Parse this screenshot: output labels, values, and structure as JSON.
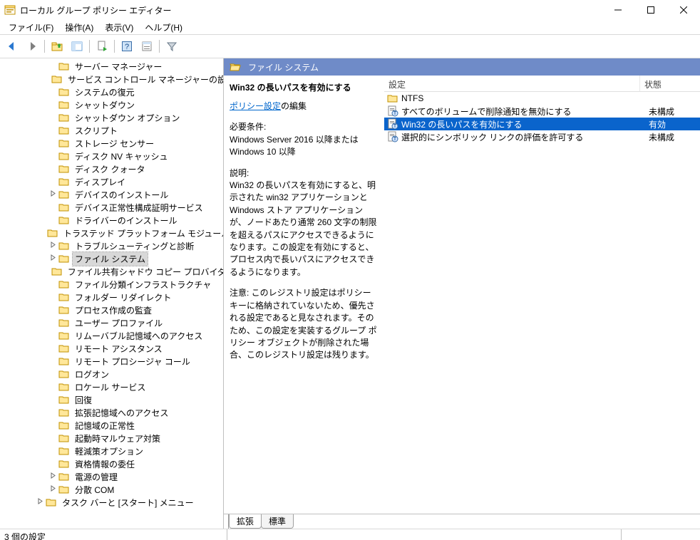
{
  "window": {
    "title": "ローカル グループ ポリシー エディター"
  },
  "menus": [
    "ファイル(F)",
    "操作(A)",
    "表示(V)",
    "ヘルプ(H)"
  ],
  "tree": {
    "indent_base": 66,
    "nodes": [
      {
        "label": "サーバー マネージャー",
        "children": false
      },
      {
        "label": "サービス コントロール マネージャーの設定",
        "children": false
      },
      {
        "label": "システムの復元",
        "children": false
      },
      {
        "label": "シャットダウン",
        "children": false
      },
      {
        "label": "シャットダウン オプション",
        "children": false
      },
      {
        "label": "スクリプト",
        "children": false
      },
      {
        "label": "ストレージ センサー",
        "children": false
      },
      {
        "label": "ディスク NV キャッシュ",
        "children": false
      },
      {
        "label": "ディスク クォータ",
        "children": false
      },
      {
        "label": "ディスプレイ",
        "children": false
      },
      {
        "label": "デバイスのインストール",
        "children": true
      },
      {
        "label": "デバイス正常性構成証明サービス",
        "children": false
      },
      {
        "label": "ドライバーのインストール",
        "children": false
      },
      {
        "label": "トラステッド プラットフォーム モジュール サー",
        "children": false
      },
      {
        "label": "トラブルシューティングと診断",
        "children": true
      },
      {
        "label": "ファイル システム",
        "children": true,
        "active": true
      },
      {
        "label": "ファイル共有シャドウ コピー プロバイダー",
        "children": false
      },
      {
        "label": "ファイル分類インフラストラクチャ",
        "children": false
      },
      {
        "label": "フォルダー リダイレクト",
        "children": false
      },
      {
        "label": "プロセス作成の監査",
        "children": false
      },
      {
        "label": "ユーザー プロファイル",
        "children": false
      },
      {
        "label": "リムーバブル記憶域へのアクセス",
        "children": false
      },
      {
        "label": "リモート アシスタンス",
        "children": false
      },
      {
        "label": "リモート プロシージャ コール",
        "children": false
      },
      {
        "label": "ログオン",
        "children": false
      },
      {
        "label": "ロケール サービス",
        "children": false
      },
      {
        "label": "回復",
        "children": false
      },
      {
        "label": "拡張記憶域へのアクセス",
        "children": false
      },
      {
        "label": "記憶域の正常性",
        "children": false
      },
      {
        "label": "起動時マルウェア対策",
        "children": false
      },
      {
        "label": "軽減策オプション",
        "children": false
      },
      {
        "label": "資格情報の委任",
        "children": false
      },
      {
        "label": "電源の管理",
        "children": true
      },
      {
        "label": "分散 COM",
        "children": true
      },
      {
        "label": "タスク バーと [スタート] メニュー",
        "children": true,
        "indent": 48
      }
    ]
  },
  "rightHeader": "ファイル システム",
  "description": {
    "title": "Win32 の長いパスを有効にする",
    "edit_link": "ポリシー設定",
    "edit_suffix": "の編集",
    "req_label": "必要条件:",
    "req_text": "Windows Server 2016 以降または Windows 10 以降",
    "desc_label": "説明:",
    "desc_text": "Win32 の長いパスを有効にすると、明示された win32 アプリケーションと Windows ストア アプリケーションが、ノードあたり通常 260 文字の制限を超えるパスにアクセスできるようになります。この設定を有効にすると、プロセス内で長いパスにアクセスできるようになります。",
    "note_text": "注意: このレジストリ設定はポリシー キーに格納されていないため、優先される設定であると見なされます。そのため、この設定を実装するグループ ポリシー オブジェクトが削除された場合、このレジストリ設定は残ります。"
  },
  "list": {
    "col_setting": "設定",
    "col_state": "状態",
    "rows": [
      {
        "icon": "folder",
        "name": "NTFS",
        "state": ""
      },
      {
        "icon": "policy",
        "name": "すべてのボリュームで削除通知を無効にする",
        "state": "未構成"
      },
      {
        "icon": "policy",
        "name": "Win32 の長いパスを有効にする",
        "state": "有効",
        "selected": true
      },
      {
        "icon": "policy",
        "name": "選択的にシンボリック リンクの評価を許可する",
        "state": "未構成"
      }
    ]
  },
  "tabs": {
    "extended": "拡張",
    "standard": "標準"
  },
  "statusbar": "3 個の設定"
}
